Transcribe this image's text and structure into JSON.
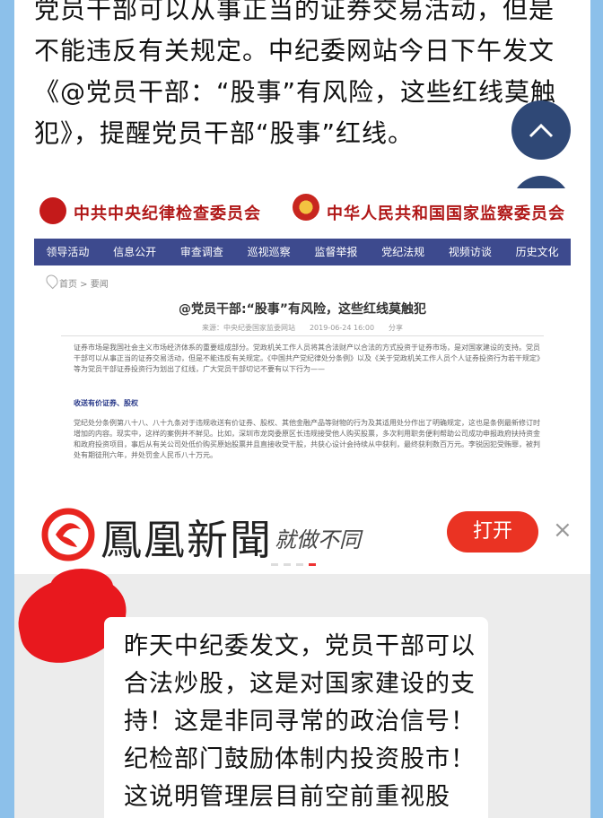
{
  "article": {
    "paragraph": "党员干部可以从事正当的证券交易活动，但是不能违反有关规定。中纪委网站今日下午发文《@党员干部：“股事”有风险，这些红线莫触犯》，提醒党员干部“股事”红线。"
  },
  "floating_buttons": {
    "up_icon": "chevron-up-icon",
    "home_icon": "home-icon"
  },
  "embedded_screenshot": {
    "org1": "中共中央纪律检查委员会",
    "org2": "中华人民共和国国家监察委员会",
    "nav": [
      "领导活动",
      "信息公开",
      "审查调查",
      "巡视巡察",
      "监督举报",
      "党纪法规",
      "视频访谈",
      "历史文化"
    ],
    "breadcrumb": "首页 > 要闻",
    "title": "@党员干部:“股事”有风险，这些红线莫触犯",
    "meta": "来源：中央纪委国家监委网站　　2019-06-24 16:00　　分享",
    "p1": "证券市场是我国社会主义市场经济体系的重要组成部分。党政机关工作人员将其合法财产以合法的方式投资于证券市场，是对国家建设的支持。党员干部可以从事正当的证券交易活动，但是不能违反有关规定。《中国共产党纪律处分条例》以及《关于党政机关工作人员个人证券投资行为若干规定》等为党员干部证券投资行为划出了红线，广大党员干部切记不要有以下行为——",
    "heading": "收送有价证券、股权",
    "p2": "党纪处分条例第八十八、八十九条对于违规收送有价证券、股权、其他金融产品等财物的行为及其适用处分作出了明确规定，这也是条例最新修订时增加的内容。现实中，这样的案例并不鲜见。比如，深圳市龙岗委原区长违规接受他人购买股票，多次利用职务便利帮助公司成功申报政府扶持资金和政府投资项目，事后从有关公司处低价购买原始股票并且直接收受干股，共获心设计会持续从中获利，最终获利数百万元。李锐因犯受贿罪，被判处有期徒刑六年，并处罚金人民币八十万元。"
  },
  "ad": {
    "app_name": "鳳凰新聞",
    "slogan": "就做不同",
    "open_label": "打开",
    "close_label": "×",
    "logo_icon": "ifeng-phoenix-logo"
  },
  "chat": {
    "message": "昨天中纪委发文，党员干部可以合法炒股，这是对国家建设的支持！这是非同寻常的政治信号！纪检部门鼓励体制内投资股市！这说明管理层目前空前重视股市，上上下下全面呵"
  },
  "colors": {
    "frame": "#8cc0ea",
    "float_button": "#2f4876",
    "nav_bar": "#3d4a8e",
    "open_button": "#ea3323",
    "redaction": "#e8181e"
  }
}
